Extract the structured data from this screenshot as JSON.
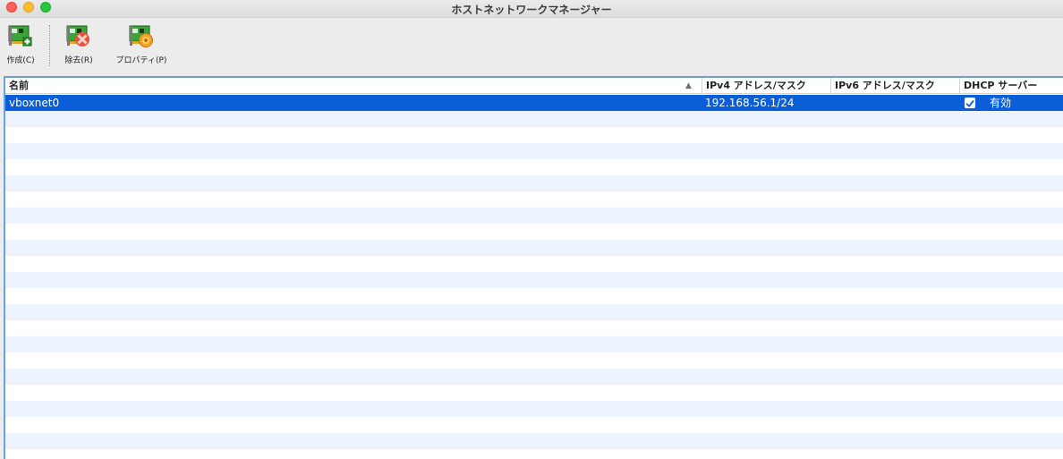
{
  "window": {
    "title": "ホストネットワークマネージャー"
  },
  "toolbar": {
    "create_label": "作成(C)",
    "remove_label": "除去(R)",
    "properties_label": "プロパティ(P)"
  },
  "table": {
    "columns": {
      "name": "名前",
      "ipv4": "IPv4 アドレス/マスク",
      "ipv6": "IPv6 アドレス/マスク",
      "dhcp": "DHCP サーバー"
    },
    "sort_indicator": "▲",
    "rows": [
      {
        "name": "vboxnet0",
        "ipv4": "192.168.56.1/24",
        "ipv6": "",
        "dhcp_label": "有効",
        "dhcp_checked": true,
        "selected": true
      }
    ]
  },
  "colors": {
    "selection": "#0a5fd8",
    "stripe": "#edf3fe",
    "table_border": "#6e9fd8"
  },
  "icons": {
    "create": "network-card-add-icon",
    "remove": "network-card-remove-icon",
    "properties": "network-card-settings-icon",
    "checkbox": "checkmark-icon"
  }
}
